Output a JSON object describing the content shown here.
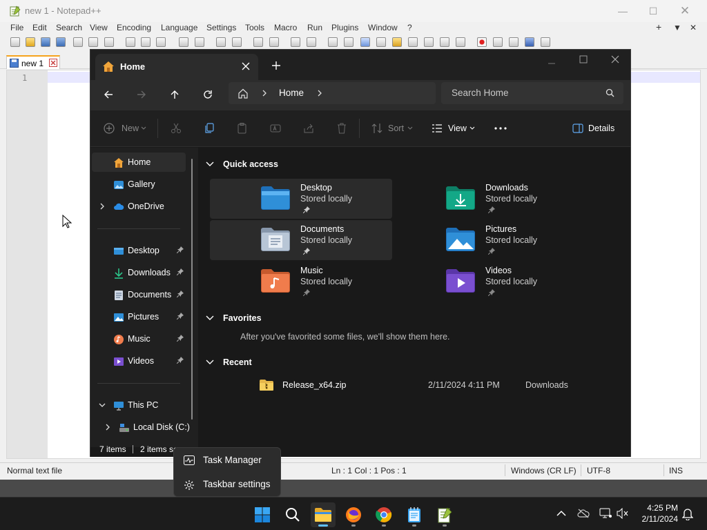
{
  "notepad": {
    "title": "new 1 - Notepad++",
    "menu": [
      "File",
      "Edit",
      "Search",
      "View",
      "Encoding",
      "Language",
      "Settings",
      "Tools",
      "Macro",
      "Run",
      "Plugins",
      "Window",
      "?"
    ],
    "tab_label": "new 1",
    "line_number": "1",
    "status": {
      "mode": "Normal text file",
      "position": "Ln : 1    Col : 1    Pos : 1",
      "eol": "Windows (CR LF)",
      "encoding": "UTF-8",
      "insert": "INS"
    }
  },
  "explorer": {
    "tab_title": "Home",
    "breadcrumb": "Home",
    "search_placeholder": "Search Home",
    "toolbar": {
      "new": "New",
      "sort": "Sort",
      "view": "View",
      "details": "Details"
    },
    "nav": {
      "home": "Home",
      "gallery": "Gallery",
      "onedrive": "OneDrive",
      "desktop": "Desktop",
      "downloads": "Downloads",
      "documents": "Documents",
      "pictures": "Pictures",
      "music": "Music",
      "videos": "Videos",
      "this_pc": "This PC",
      "local_disk": "Local Disk (C:)"
    },
    "quick_access_heading": "Quick access",
    "quick_access": [
      {
        "name": "Desktop",
        "sub": "Stored locally"
      },
      {
        "name": "Downloads",
        "sub": "Stored locally"
      },
      {
        "name": "Documents",
        "sub": "Stored locally"
      },
      {
        "name": "Pictures",
        "sub": "Stored locally"
      },
      {
        "name": "Music",
        "sub": "Stored locally"
      },
      {
        "name": "Videos",
        "sub": "Stored locally"
      }
    ],
    "favorites_heading": "Favorites",
    "favorites_empty": "After you've favorited some files, we'll show them here.",
    "recent_heading": "Recent",
    "recent": [
      {
        "name": "Release_x64.zip",
        "date": "2/11/2024 4:11 PM",
        "location": "Downloads"
      }
    ],
    "status": {
      "items": "7 items",
      "selected": "2 items se"
    }
  },
  "context_menu": {
    "task_manager": "Task Manager",
    "taskbar_settings": "Taskbar settings"
  },
  "taskbar": {
    "time": "4:25 PM",
    "date": "2/11/2024"
  },
  "colors": {
    "explorer_bg": "#191919",
    "folder_blue": "#2f8fd8",
    "downloads_teal": "#13a887",
    "music_orange": "#f07c4c",
    "videos_purple": "#7a4fd0",
    "win_blue": "#0a7ed7"
  }
}
